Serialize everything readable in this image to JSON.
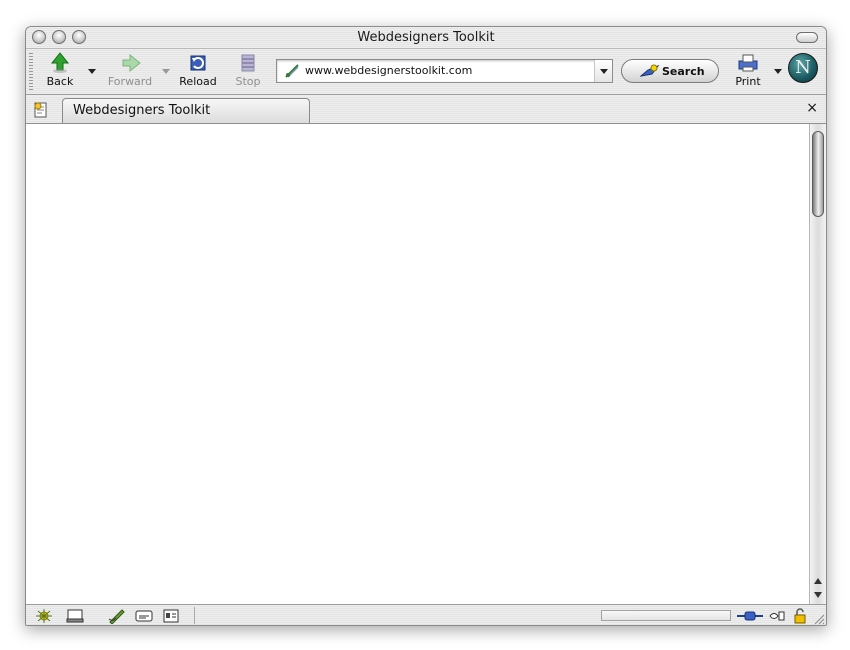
{
  "window": {
    "title": "Webdesigners Toolkit"
  },
  "toolbar": {
    "back_label": "Back",
    "forward_label": "Forward",
    "reload_label": "Reload",
    "stop_label": "Stop",
    "print_label": "Print",
    "search_label": "Search"
  },
  "urlbar": {
    "value": "www.webdesignerstoolkit.com"
  },
  "tabs": [
    {
      "label": "Webdesigners Toolkit",
      "active": true
    }
  ],
  "tabbar": {
    "close_glyph": "×"
  },
  "colors": {
    "accent_green": "#2ea12e",
    "netscape_teal": "#1c5f66"
  },
  "icons": {
    "back": "back-arrow-icon",
    "forward": "forward-arrow-icon",
    "reload": "reload-icon",
    "stop": "stop-icon",
    "search": "search-icon",
    "print": "print-icon",
    "throbber": "netscape-logo-icon"
  }
}
